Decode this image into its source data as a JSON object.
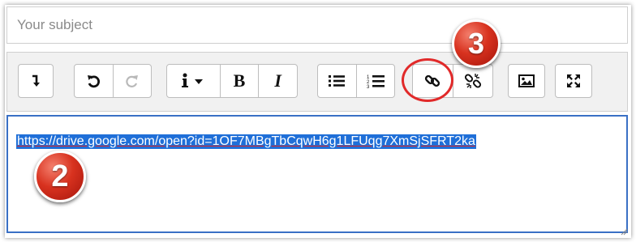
{
  "subject": {
    "placeholder": "Your subject",
    "value": ""
  },
  "toolbar": {
    "buttons": [
      {
        "name": "collapse-toolbar-button",
        "icon": "arrow-down-return-icon"
      },
      {
        "name": "undo-button",
        "icon": "undo-icon"
      },
      {
        "name": "redo-button",
        "icon": "redo-icon",
        "disabled": true
      },
      {
        "name": "paragraph-styles-button",
        "icon": "info-dropdown-icon"
      },
      {
        "name": "bold-button",
        "label": "B"
      },
      {
        "name": "italic-button",
        "label": "I"
      },
      {
        "name": "unordered-list-button",
        "icon": "bullet-list-icon"
      },
      {
        "name": "ordered-list-button",
        "icon": "numbered-list-icon"
      },
      {
        "name": "link-button",
        "icon": "link-icon"
      },
      {
        "name": "unlink-button",
        "icon": "unlink-icon"
      },
      {
        "name": "insert-image-button",
        "icon": "image-icon"
      },
      {
        "name": "fullscreen-button",
        "icon": "fullscreen-icon"
      }
    ],
    "bold_label": "B",
    "italic_label": "I"
  },
  "editor": {
    "selected_text": "https://drive.google.com/open?id=1OF7MBgTbCqwH6g1LFUqg7XmSjSFRT2ka"
  },
  "annotations": [
    {
      "label": "2",
      "color": "#d8321f"
    },
    {
      "label": "3",
      "color": "#d8321f"
    }
  ]
}
